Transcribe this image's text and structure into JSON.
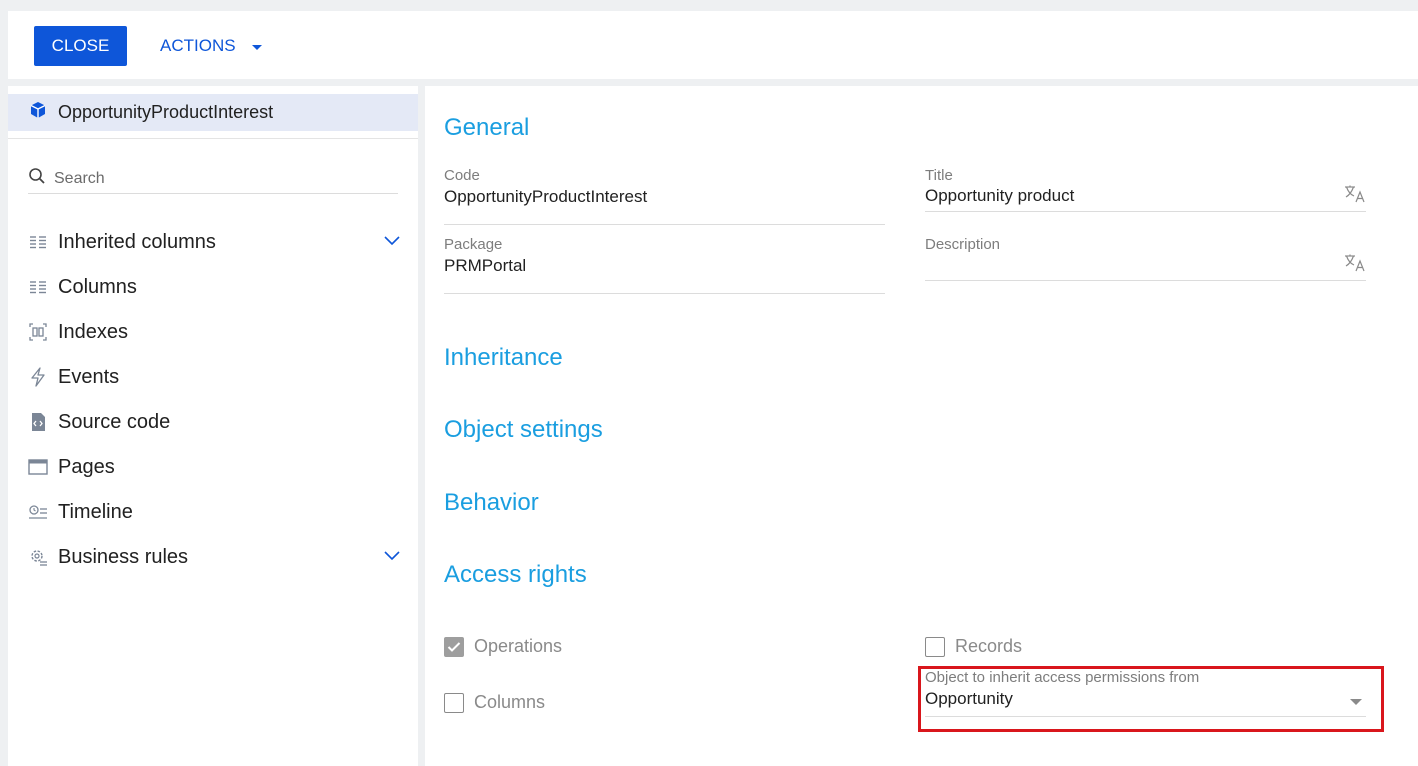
{
  "toolbar": {
    "close_label": "CLOSE",
    "actions_label": "ACTIONS"
  },
  "sidebar": {
    "object_name": "OpportunityProductInterest",
    "search_placeholder": "Search",
    "items": [
      {
        "label": "Inherited columns",
        "icon": "columns-list-icon",
        "expandable": true
      },
      {
        "label": "Columns",
        "icon": "columns-list-icon",
        "expandable": false
      },
      {
        "label": "Indexes",
        "icon": "indexes-icon",
        "expandable": false
      },
      {
        "label": "Events",
        "icon": "lightning-icon",
        "expandable": false
      },
      {
        "label": "Source code",
        "icon": "source-code-icon",
        "expandable": false
      },
      {
        "label": "Pages",
        "icon": "window-icon",
        "expandable": false
      },
      {
        "label": "Timeline",
        "icon": "timeline-icon",
        "expandable": false
      },
      {
        "label": "Business rules",
        "icon": "gear-rules-icon",
        "expandable": true
      }
    ]
  },
  "main": {
    "general_title": "General",
    "fields": {
      "code": {
        "label": "Code",
        "value": "OpportunityProductInterest"
      },
      "title": {
        "label": "Title",
        "value": "Opportunity product"
      },
      "package": {
        "label": "Package",
        "value": "PRMPortal"
      },
      "description": {
        "label": "Description",
        "value": ""
      }
    },
    "sections": {
      "inheritance": "Inheritance",
      "object_settings": "Object settings",
      "behavior": "Behavior",
      "access_rights": "Access rights"
    },
    "access": {
      "operations": {
        "label": "Operations",
        "checked": true
      },
      "records": {
        "label": "Records",
        "checked": false
      },
      "columns": {
        "label": "Columns",
        "checked": false
      },
      "inherit_from": {
        "label": "Object to inherit access permissions from",
        "value": "Opportunity"
      }
    }
  },
  "colors": {
    "primary": "#0e56d9",
    "section_title": "#1a9ee0",
    "highlight": "#d9161c",
    "selected_bg": "#e4e9f6"
  }
}
